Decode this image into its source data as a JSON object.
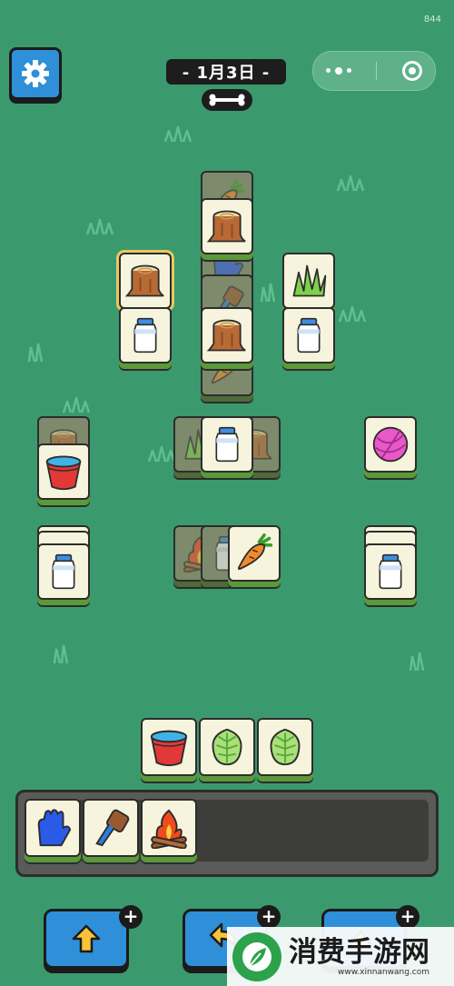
{
  "header": {
    "corner_number": "844",
    "date_label": "- 1月3日 -"
  },
  "icons": {
    "settings": "gear-icon",
    "bone": "bone-icon",
    "more": "more-dots-icon",
    "record": "target-icon"
  },
  "board_tiles": [
    {
      "item": "stump",
      "state": "active"
    },
    {
      "item": "carrot",
      "state": "covered"
    },
    {
      "item": "glove",
      "state": "covered"
    },
    {
      "item": "stump",
      "state": "active"
    },
    {
      "item": "grass",
      "state": "active"
    },
    {
      "item": "milk",
      "state": "active"
    },
    {
      "item": "stump",
      "state": "active"
    },
    {
      "item": "milk",
      "state": "active"
    },
    {
      "item": "bucket",
      "state": "active"
    },
    {
      "item": "milk",
      "state": "active"
    },
    {
      "item": "yarn",
      "state": "active"
    },
    {
      "item": "milk",
      "state": "active"
    },
    {
      "item": "carrot",
      "state": "active"
    },
    {
      "item": "milk",
      "state": "active"
    }
  ],
  "staging_tiles": [
    "bucket",
    "cabbage",
    "cabbage"
  ],
  "tray_slots": [
    "glove",
    "brush",
    "campfire"
  ],
  "powerups": [
    {
      "name": "move-out",
      "icon": "move-out-icon"
    },
    {
      "name": "undo",
      "icon": "undo-icon"
    },
    {
      "name": "shuffle",
      "icon": "shuffle-icon"
    }
  ],
  "watermark": {
    "title": "消费手游网",
    "url": "www.xinnanwang.com"
  },
  "colors": {
    "background": "#3a9a6e",
    "button_blue": "#2f8fd8",
    "tile_face": "#f6f4dc"
  }
}
